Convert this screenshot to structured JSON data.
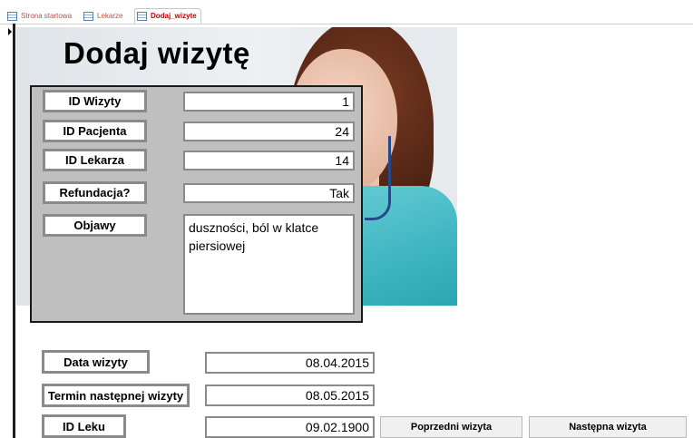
{
  "tabs": [
    {
      "label": "Strona startowa",
      "active": false
    },
    {
      "label": "Lekarze",
      "active": false
    },
    {
      "label": "Dodaj_wizyte",
      "active": true
    }
  ],
  "form": {
    "title": "Dodaj wizytę",
    "fields": {
      "id_wizyty": {
        "label": "ID Wizyty",
        "value": "1"
      },
      "id_pacjenta": {
        "label": "ID Pacjenta",
        "value": "24"
      },
      "id_lekarza": {
        "label": "ID Lekarza",
        "value": "14"
      },
      "refundacja": {
        "label": "Refundacja?",
        "value": "Tak"
      },
      "objawy": {
        "label": "Objawy",
        "value": "duszności, ból w klatce piersiowej"
      },
      "data_wizyty": {
        "label": "Data wizyty",
        "value": "08.04.2015"
      },
      "termin": {
        "label": "Termin następnej wizyty",
        "value": "08.05.2015"
      },
      "id_leku": {
        "label": "ID Leku",
        "value": "09.02.1900"
      }
    },
    "buttons": {
      "prev": "Poprzedni wizyta",
      "next": "Następna wizyta"
    }
  },
  "colors": {
    "active_tab_text": "#c00000",
    "tab_text": "#c0504d",
    "panel_bg": "#bfbfbf"
  }
}
